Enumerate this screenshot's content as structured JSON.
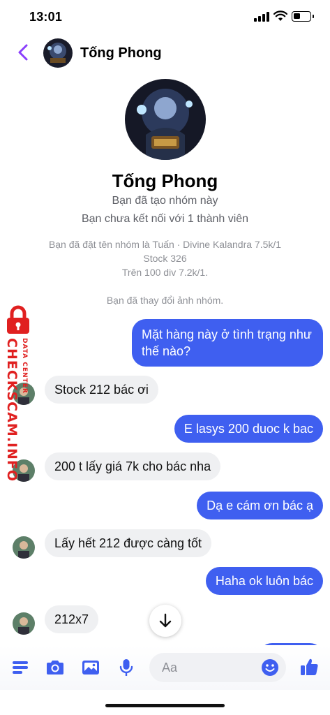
{
  "status_bar": {
    "time": "13:01"
  },
  "header": {
    "name": "Tống Phong"
  },
  "profile": {
    "name": "Tống Phong",
    "line1": "Bạn đã tạo nhóm này",
    "line2": "Bạn chưa kết nối với 1 thành viên"
  },
  "system_messages": {
    "rename_line1": "Bạn đã đặt tên nhóm là Tuấn · Divine Kalandra 7.5k/1",
    "rename_line2": "Stock 326",
    "rename_line3": "Trên 100 div 7.2k/1.",
    "photo_changed": "Bạn đã thay đổi ảnh nhóm."
  },
  "messages": [
    {
      "direction": "out",
      "line1": "Mặt hàng này ở tình trạng như",
      "line2": "thế nào?"
    },
    {
      "direction": "in",
      "text": "Stock 212 bác ơi"
    },
    {
      "direction": "out",
      "text": "E lasys 200 duoc k bac"
    },
    {
      "direction": "in",
      "text": "200 t lấy giá 7k cho bác nha"
    },
    {
      "direction": "out",
      "text": "Dạ e cám ơn bác ạ"
    },
    {
      "direction": "in",
      "text": "Lấy hết 212 được càng tốt"
    },
    {
      "direction": "out",
      "text": "Haha ok luôn bác"
    },
    {
      "direction": "in",
      "text": "212x7"
    }
  ],
  "watermark": {
    "main": "CHECKSCAM.INFO",
    "sub": "DATA CENTER"
  },
  "composer": {
    "placeholder": "Aa"
  },
  "colors": {
    "accent": "#3f5ff0",
    "incoming_bubble": "#eff0f2",
    "back_arrow": "#8a3ffc",
    "watermark": "#e02020"
  },
  "icons": [
    "chevron-left-icon",
    "signal-icon",
    "wifi-icon",
    "battery-icon",
    "menu-icon",
    "camera-icon",
    "image-icon",
    "microphone-icon",
    "emoji-icon",
    "thumbs-up-icon",
    "arrow-down-icon",
    "lock-icon"
  ]
}
